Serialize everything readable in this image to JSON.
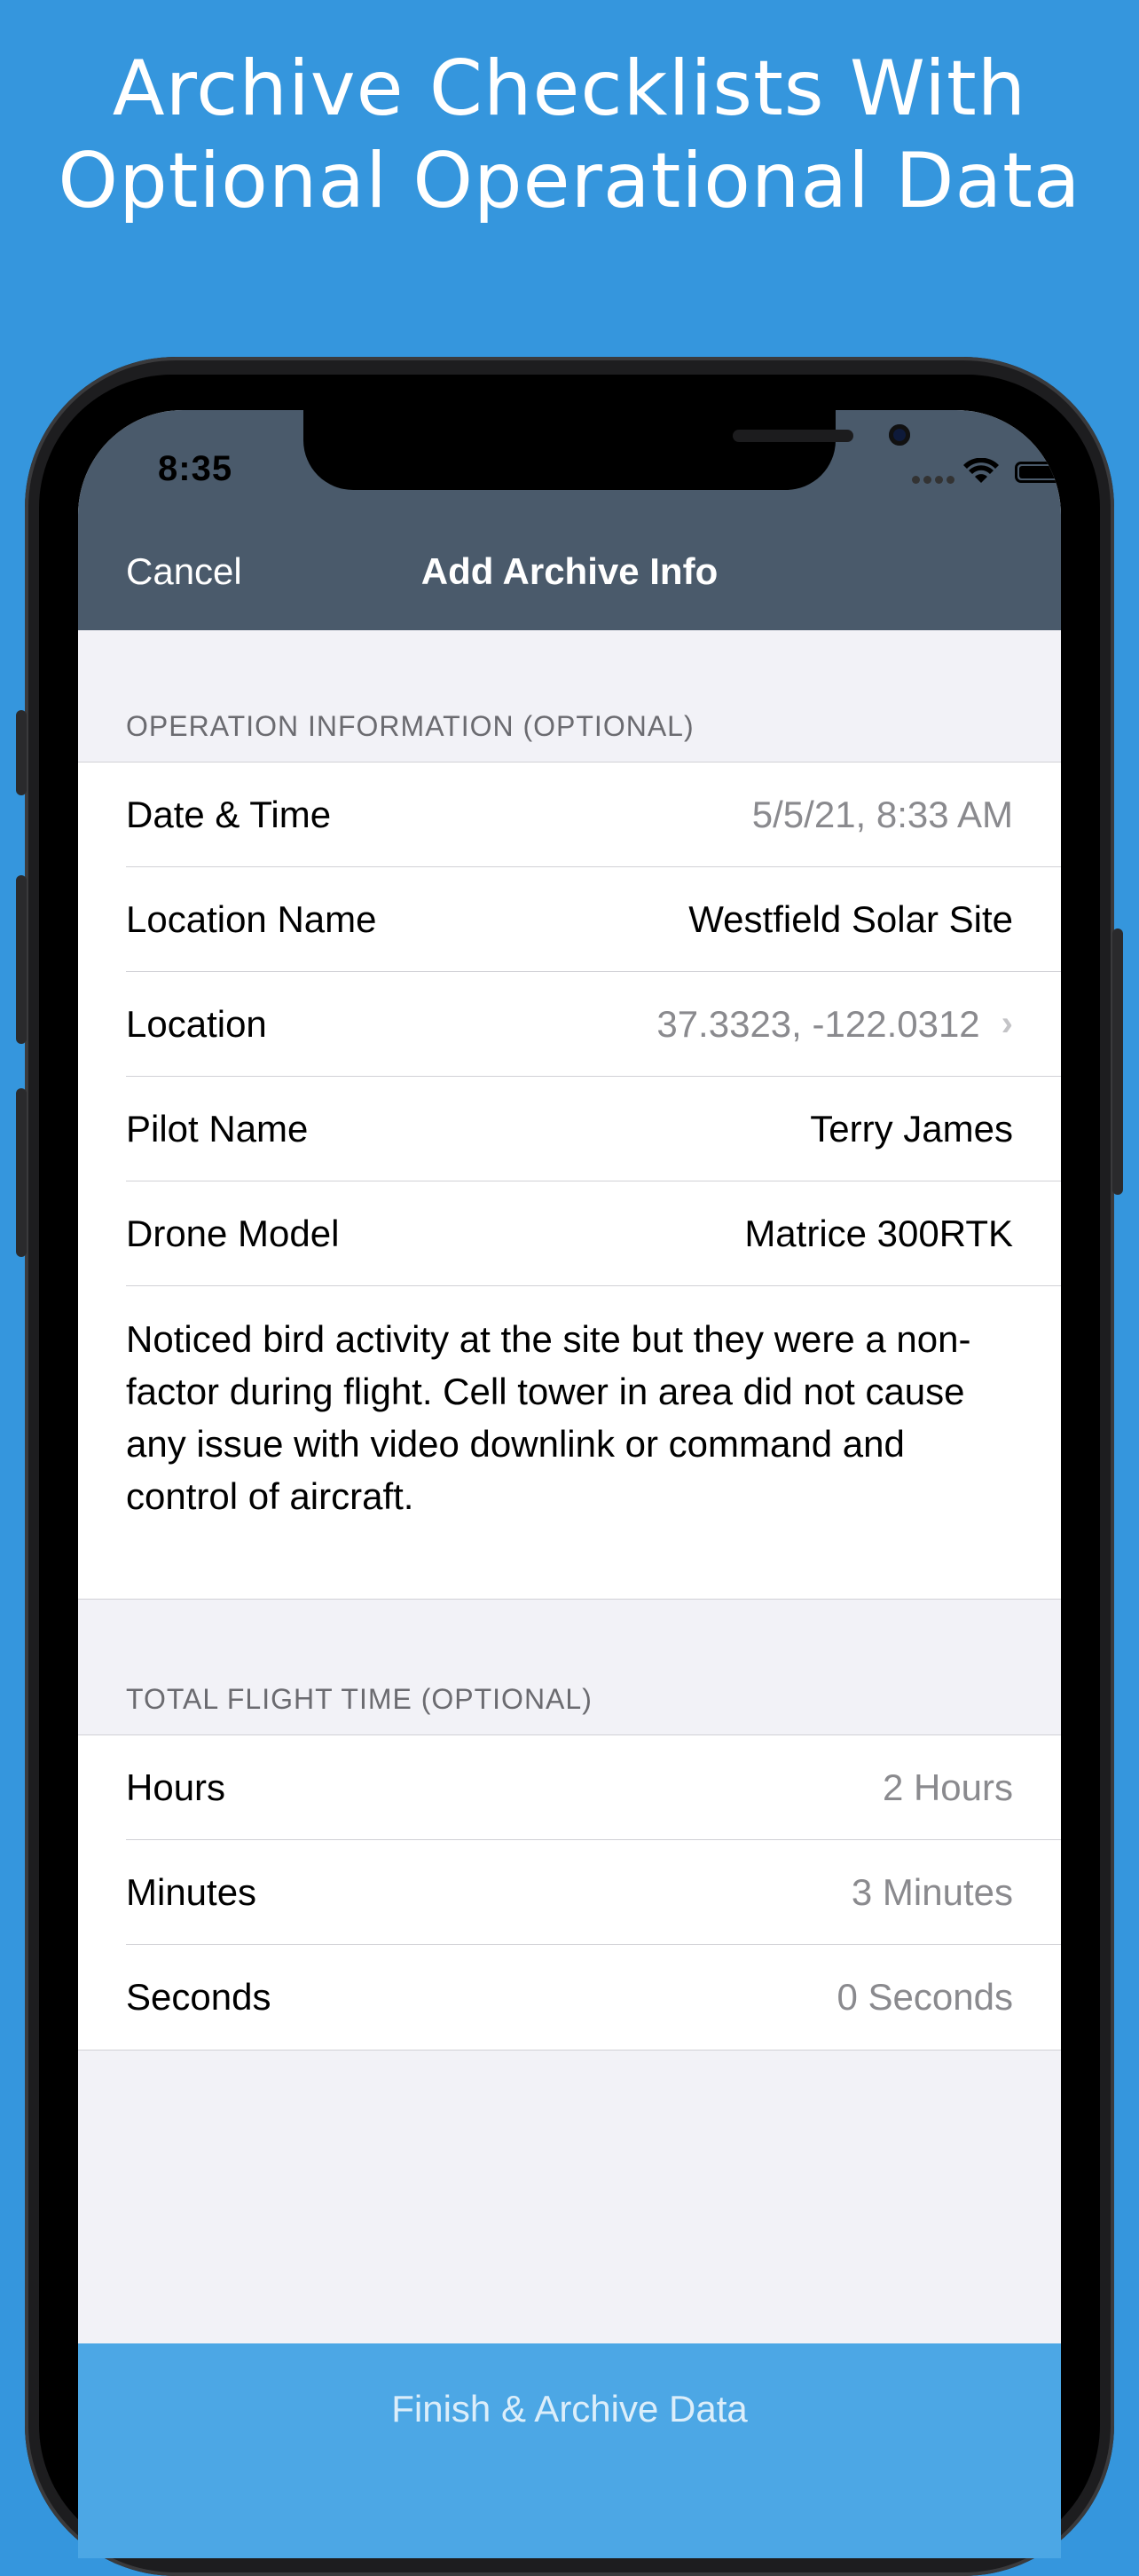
{
  "headline": {
    "line1": "Archive Checklists With",
    "line2": "Optional Operational Data"
  },
  "status_bar": {
    "time": "8:35"
  },
  "nav": {
    "cancel": "Cancel",
    "title": "Add Archive Info"
  },
  "operation_section": {
    "header": "OPERATION INFORMATION (OPTIONAL)",
    "rows": [
      {
        "label": "Date & Time",
        "value": "5/5/21, 8:33 AM"
      },
      {
        "label": "Location Name",
        "value": "Westfield Solar Site"
      },
      {
        "label": "Location",
        "value": "37.3323, -122.0312"
      },
      {
        "label": "Pilot Name",
        "value": "Terry James"
      },
      {
        "label": "Drone Model",
        "value": "Matrice 300RTK"
      }
    ],
    "notes": "Noticed bird activity at the site but they were a non-factor during flight. Cell tower in area did not cause any issue with video downlink or command and control of aircraft."
  },
  "flight_time_section": {
    "header": "TOTAL FLIGHT TIME (OPTIONAL)",
    "rows": [
      {
        "label": "Hours",
        "value": "2 Hours"
      },
      {
        "label": "Minutes",
        "value": "3 Minutes"
      },
      {
        "label": "Seconds",
        "value": "0 Seconds"
      }
    ]
  },
  "footer": {
    "finish_label": "Finish & Archive Data"
  },
  "colors": {
    "background": "#3596dd",
    "nav_bar": "#4a5a6b",
    "finish_button": "#4ca7e5",
    "secondary_text": "#8a8a8e"
  }
}
